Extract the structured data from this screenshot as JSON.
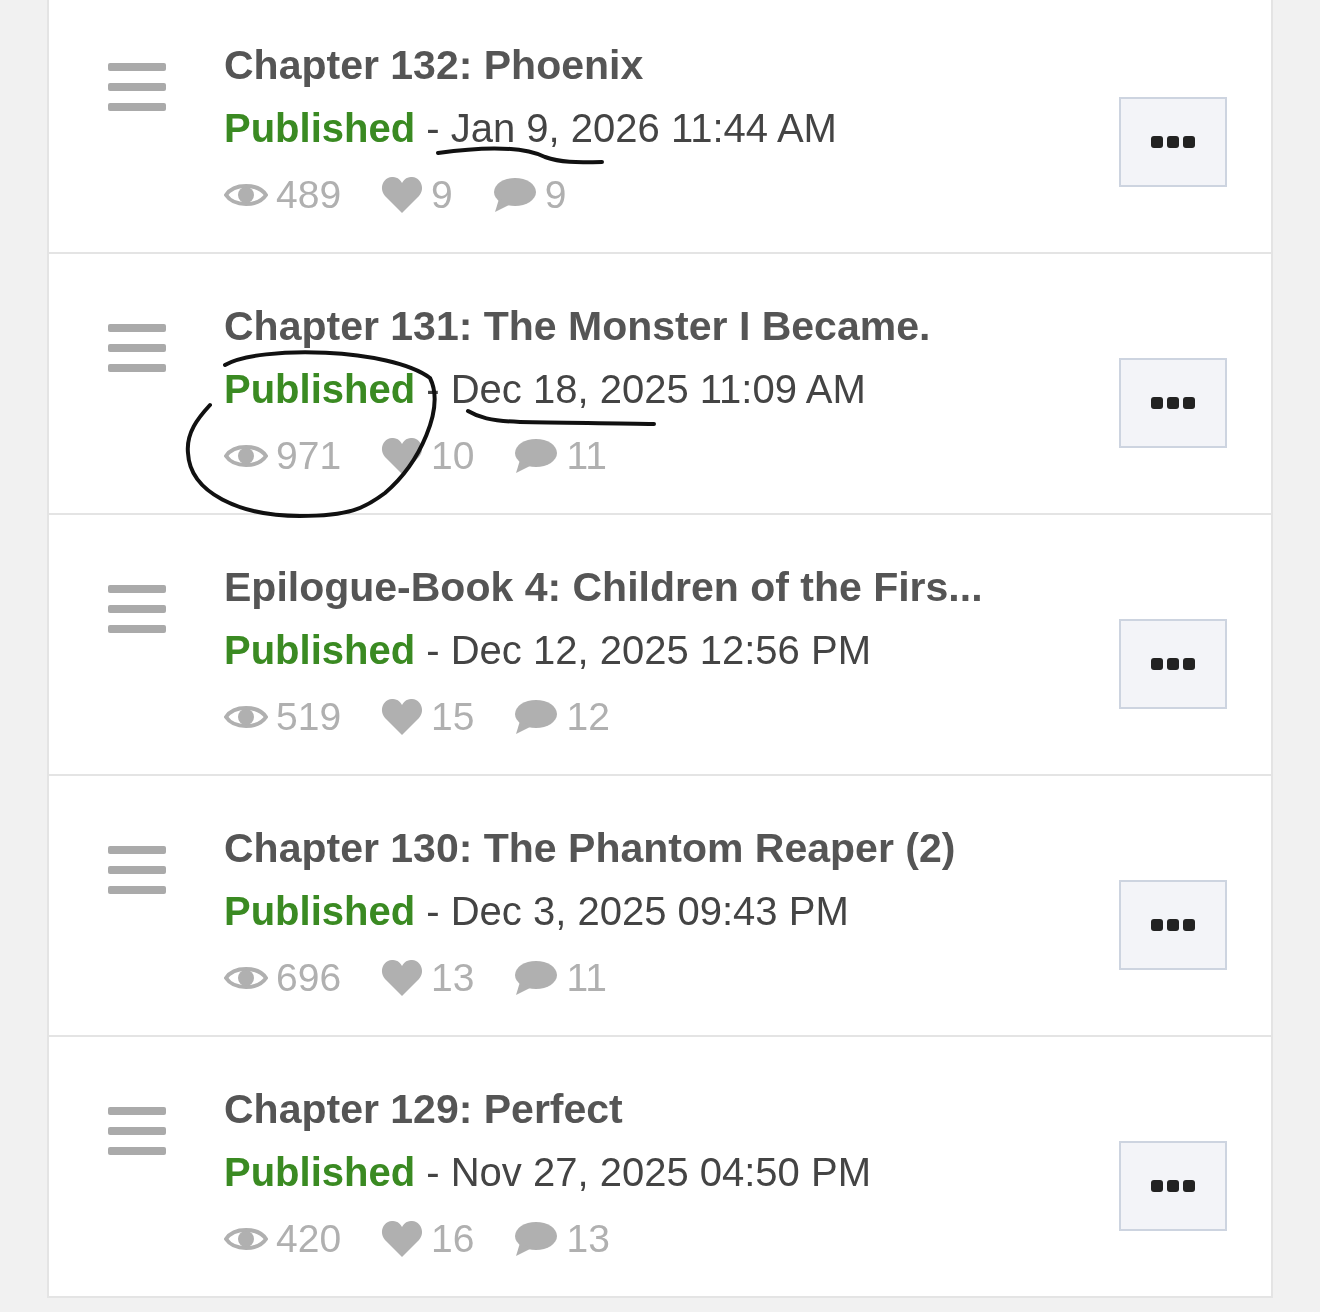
{
  "chapters": [
    {
      "title": "Chapter 132: Phoenix",
      "status": "Published",
      "date": "- Jan 9, 2026 11:44 AM",
      "views": "489",
      "likes": "9",
      "comments": "9"
    },
    {
      "title": "Chapter 131: The Monster I Became.",
      "status": "Published",
      "date": "- Dec 18, 2025 11:09 AM",
      "views": "971",
      "likes": "10",
      "comments": "11"
    },
    {
      "title": "Epilogue-Book 4: Children of the Firs...",
      "status": "Published",
      "date": "- Dec 12, 2025 12:56 PM",
      "views": "519",
      "likes": "15",
      "comments": "12"
    },
    {
      "title": "Chapter 130: The Phantom Reaper (2)",
      "status": "Published",
      "date": "- Dec 3, 2025 09:43 PM",
      "views": "696",
      "likes": "13",
      "comments": "11"
    },
    {
      "title": "Chapter 129: Perfect",
      "status": "Published",
      "date": "- Nov 27, 2025 04:50 PM",
      "views": "420",
      "likes": "16",
      "comments": "13"
    }
  ]
}
